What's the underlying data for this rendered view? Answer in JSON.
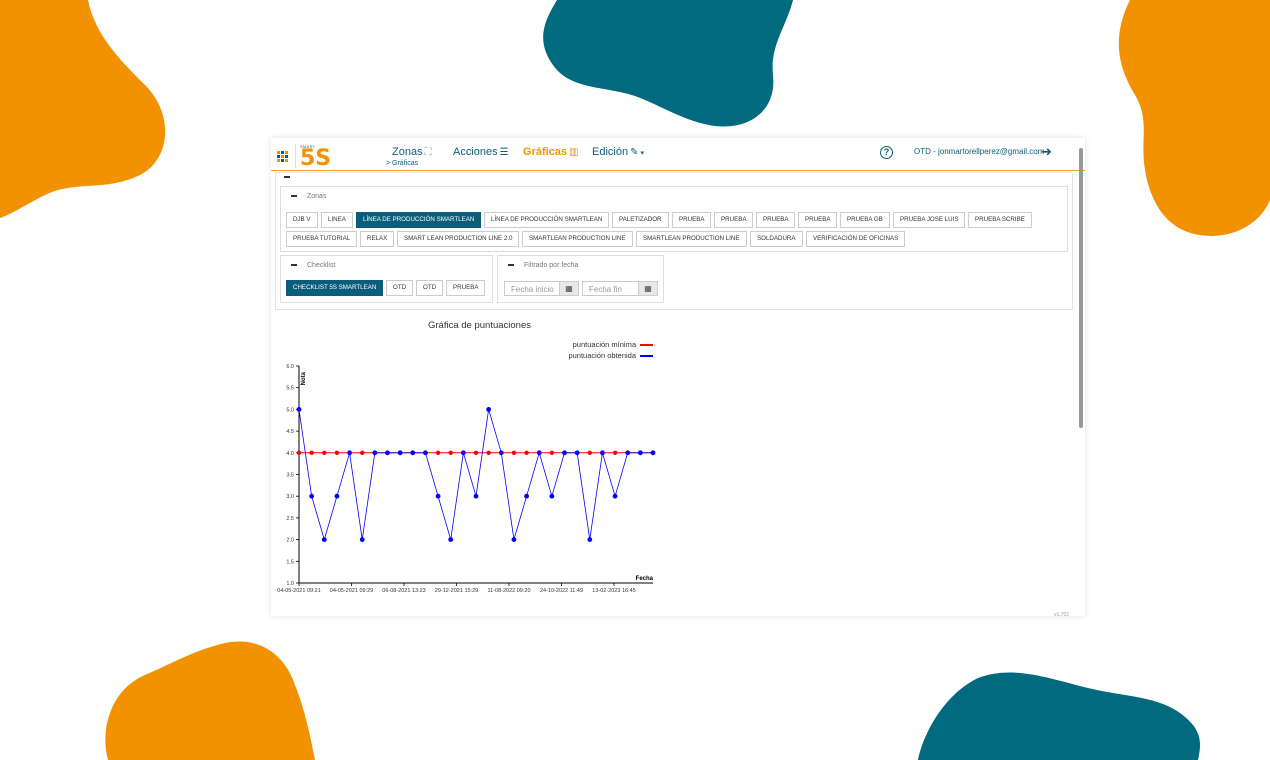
{
  "header": {
    "logo_small": "SMART",
    "logo_big": "5S",
    "nav": [
      {
        "label": "Zonas",
        "icon": "map-icon"
      },
      {
        "label": "Acciones",
        "icon": "list-icon"
      },
      {
        "label": "Gráficas",
        "icon": "bar-chart-icon"
      },
      {
        "label": "Edición",
        "icon": "edit-icon"
      }
    ],
    "breadcrumb": "> Gráficas",
    "user": "OTD - jonmartorellperez@gmail.com"
  },
  "zonas": {
    "title": "Zonas",
    "chips": [
      "DJB V",
      "LINEA",
      "LÍNEA DE PRODUCCIÓN SMARTLEAN",
      "LÍNEA DE PRODUCCIÓN SMARTLEAN",
      "PALETIZADOR",
      "PRUEBA",
      "PRUEBA",
      "PRUEBA",
      "PRUEBA",
      "PRUEBA GB",
      "PRUEBA JOSE LUIS",
      "PRUEBA SCRIBE",
      "PRUEBA TUTORIAL",
      "RELAX",
      "SMART LEAN PRODUCTION LINE 2.0",
      "SMARTLEAN PRODUCTION LINE",
      "SMARTLEAN PRODUCTION LINE",
      "SOLDADURA",
      "VERIFICACIÓN DE OFICINAS"
    ],
    "selected": 2
  },
  "checklist": {
    "title": "Checklist",
    "chips": [
      "CHECKLIST 5S SMARTLEAN",
      "OTD",
      "OTD",
      "PRUEBA"
    ],
    "selected": 0
  },
  "fecha": {
    "title": "Filtrado por fecha",
    "start_placeholder": "Fecha inicio",
    "end_placeholder": "Fecha fin"
  },
  "colors": {
    "teal": "#0b5e7b",
    "orange": "#f39200",
    "red": "#ff0000",
    "blue": "#0000ff"
  },
  "chart_data": {
    "type": "line",
    "title": "Gráfica de puntuaciones",
    "xlabel": "Fecha",
    "ylabel": "Nota",
    "ylim": [
      1.0,
      6.0
    ],
    "yticks": [
      "1.0",
      "1.5",
      "2.0",
      "2.5",
      "3.0",
      "3.5",
      "4.0",
      "4.5",
      "5.0",
      "5.5",
      "6.0"
    ],
    "xtick_labels": [
      "04-05-2021 09:21",
      "04-05-2021 09:29",
      "06-08-2021 13:23",
      "29-12-2021 15:29",
      "11-08-2022 09:20",
      "24-10-2022 11:49",
      "13-02-2023 16:45"
    ],
    "legend": [
      "puntuación mínima",
      "puntuación obtenida"
    ],
    "legend_position": "top-right",
    "series": [
      {
        "name": "puntuación mínima",
        "color": "#ff0000",
        "values": [
          4,
          4,
          4,
          4,
          4,
          4,
          4,
          4,
          4,
          4,
          4,
          4,
          4,
          4,
          4,
          4,
          4,
          4,
          4,
          4,
          4,
          4,
          4,
          4,
          4,
          4,
          4,
          4
        ]
      },
      {
        "name": "puntuación obtenida",
        "color": "#0000ff",
        "values": [
          5,
          3,
          2,
          3,
          4,
          2,
          4,
          4,
          4,
          4,
          4,
          3,
          2,
          4,
          3,
          5,
          4,
          2,
          3,
          4,
          3,
          4,
          4,
          2,
          4,
          3,
          4,
          4,
          4
        ]
      }
    ]
  },
  "footer": {
    "version": "v1.702"
  }
}
